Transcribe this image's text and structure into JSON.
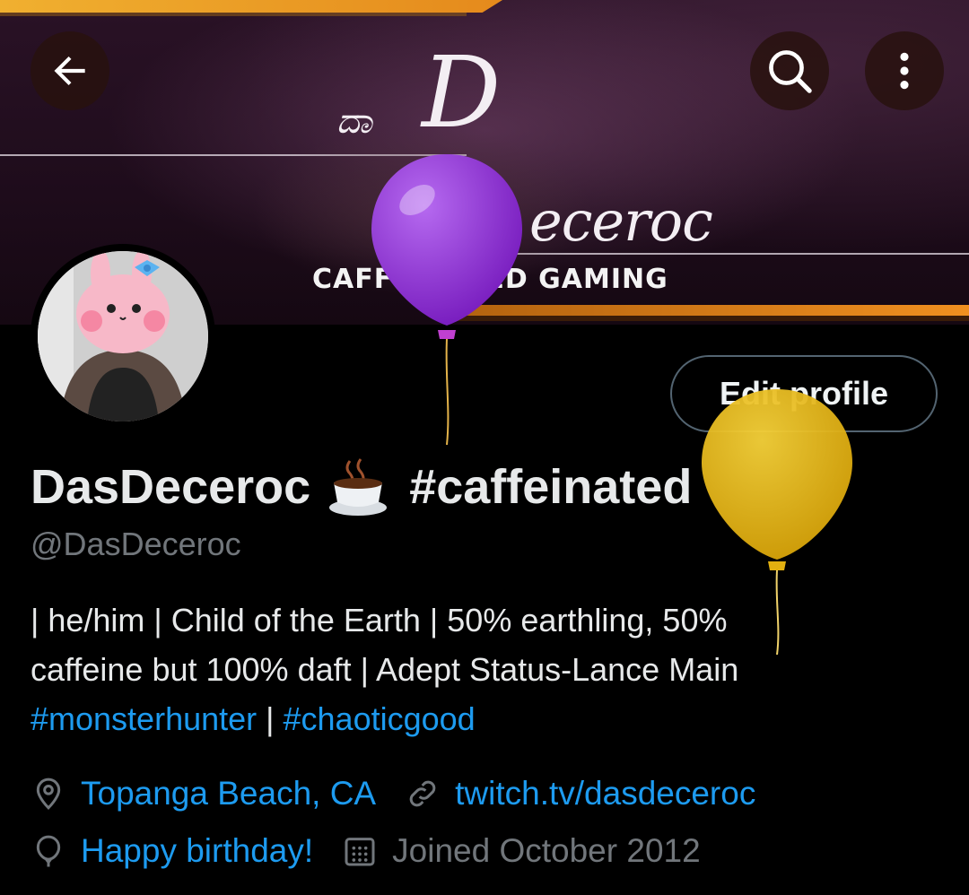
{
  "banner": {
    "logo_prefix": "ದಾ",
    "logo_initial": "D",
    "logo_rest": "eceroc",
    "logo_subtitle": "CAFFEINATED GAMING"
  },
  "header": {
    "back_icon": "arrow-left-icon",
    "search_icon": "search-icon",
    "more_icon": "more-vertical-icon"
  },
  "profile": {
    "display_name": "DasDeceroc",
    "name_emoji": "hot-beverage-emoji",
    "name_hashtag": "#caffeinated",
    "handle": "@DasDeceroc",
    "edit_button_label": "Edit profile",
    "bio": {
      "line1": "| he/him | Child of the Earth | 50% earthling, 50%",
      "line2": "caffeine but 100% daft | Adept Status-Lance Main",
      "hashtag1": "#monsterhunter",
      "separator": " | ",
      "hashtag2": "#chaoticgood"
    },
    "location": "Topanga Beach, CA",
    "website": "twitch.tv/dasdeceroc",
    "birthday": "Happy birthday!",
    "joined": "Joined October 2012"
  },
  "colors": {
    "accent_link": "#1d9bf0",
    "muted_text": "#71767b",
    "balloon_purple": "#9b3ddb",
    "balloon_yellow": "#e7b40e"
  }
}
